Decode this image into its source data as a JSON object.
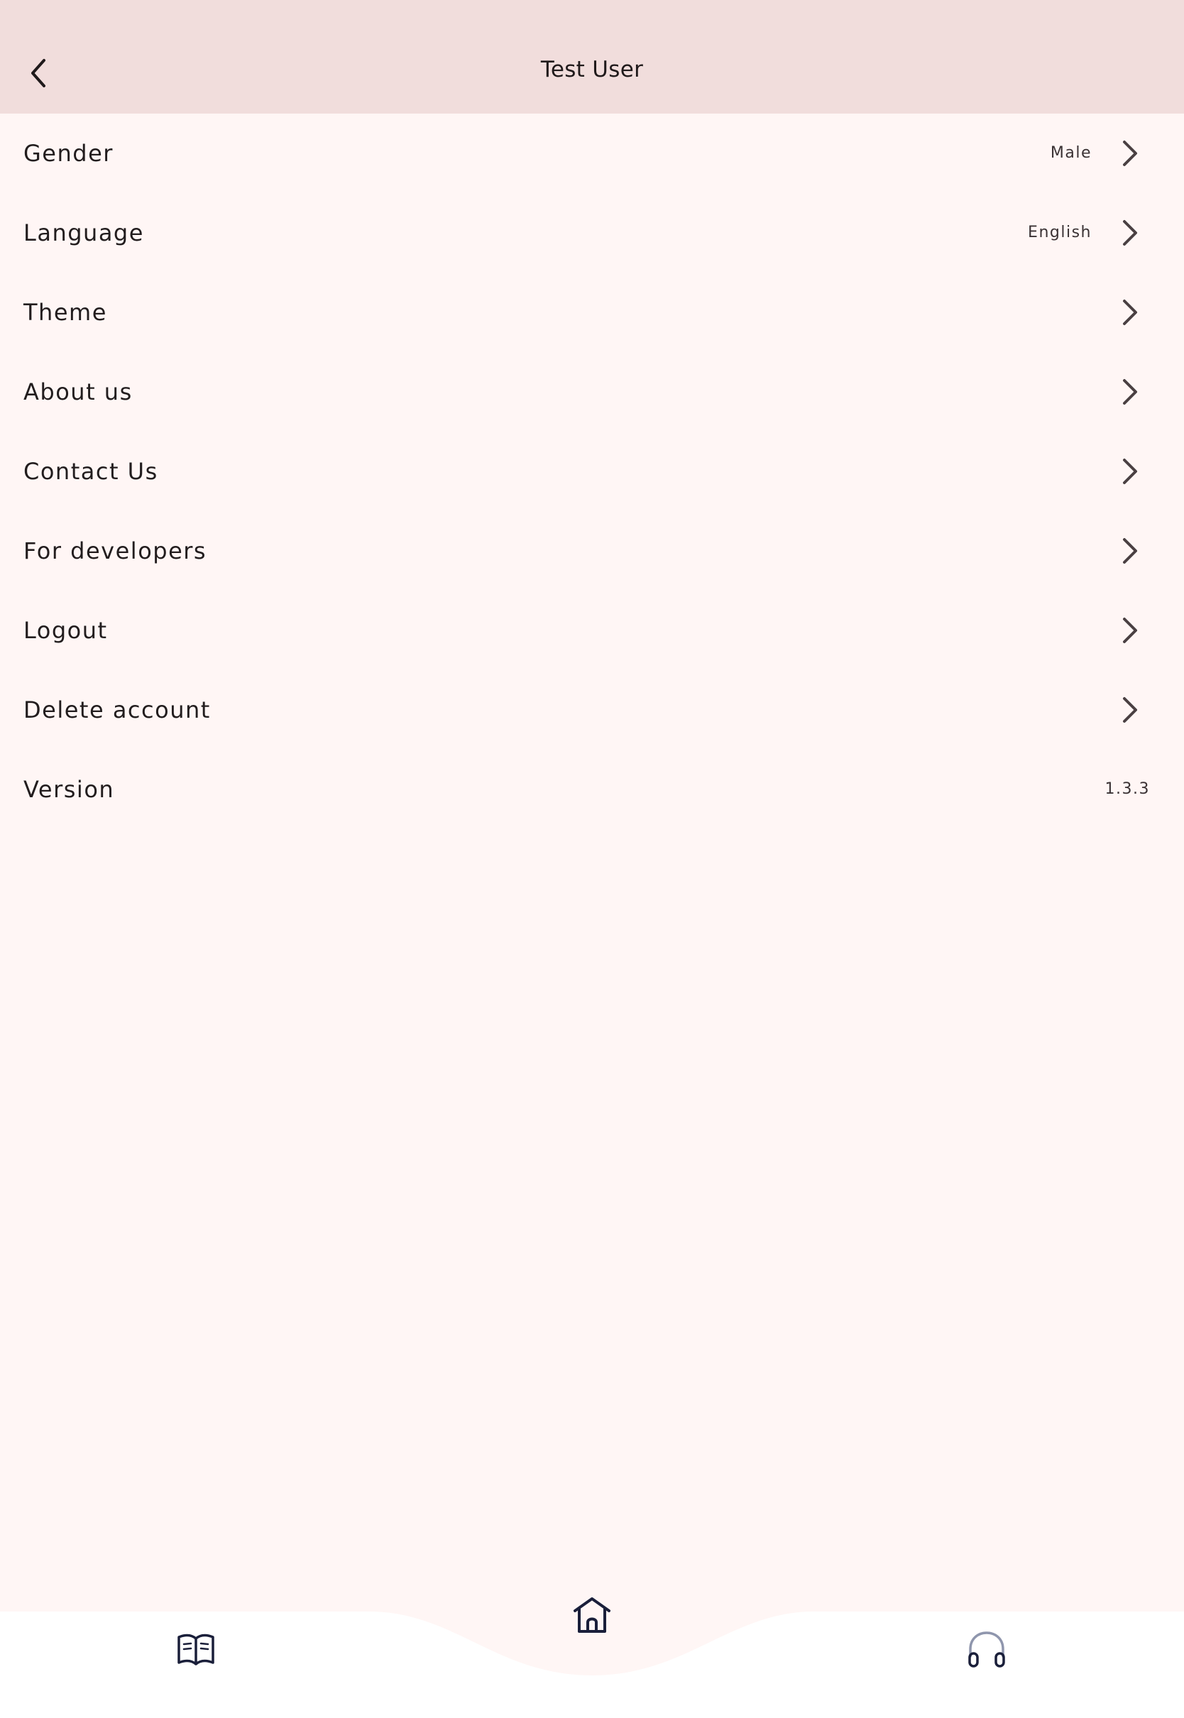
{
  "app_bar": {
    "title": "Test User",
    "back_icon": "chevron-left-icon"
  },
  "settings": [
    {
      "key": "gender",
      "label": "Gender",
      "value": "Male",
      "chevron": true
    },
    {
      "key": "language",
      "label": "Language",
      "value": "English",
      "chevron": true
    },
    {
      "key": "theme",
      "label": "Theme",
      "value": "",
      "chevron": true
    },
    {
      "key": "about-us",
      "label": "About us",
      "value": "",
      "chevron": true
    },
    {
      "key": "contact-us",
      "label": "Contact Us",
      "value": "",
      "chevron": true
    },
    {
      "key": "for-developers",
      "label": "For developers",
      "value": "",
      "chevron": true
    },
    {
      "key": "logout",
      "label": "Logout",
      "value": "",
      "chevron": true
    },
    {
      "key": "delete-account",
      "label": "Delete account",
      "value": "",
      "chevron": true
    },
    {
      "key": "version",
      "label": "Version",
      "value": "1.3.3",
      "chevron": false
    }
  ],
  "bottom_nav": {
    "items": [
      {
        "key": "read",
        "icon": "open-book-icon"
      },
      {
        "key": "home",
        "icon": "home-icon",
        "active": true
      },
      {
        "key": "listen",
        "icon": "headphones-icon"
      }
    ]
  },
  "colors": {
    "app_bar_bg": "#f1dddc",
    "page_bg": "#fff6f5",
    "bottom_bar_bg": "#ffffff",
    "icon_color": "#1a1f3a",
    "chevron_color": "#4a4042"
  }
}
